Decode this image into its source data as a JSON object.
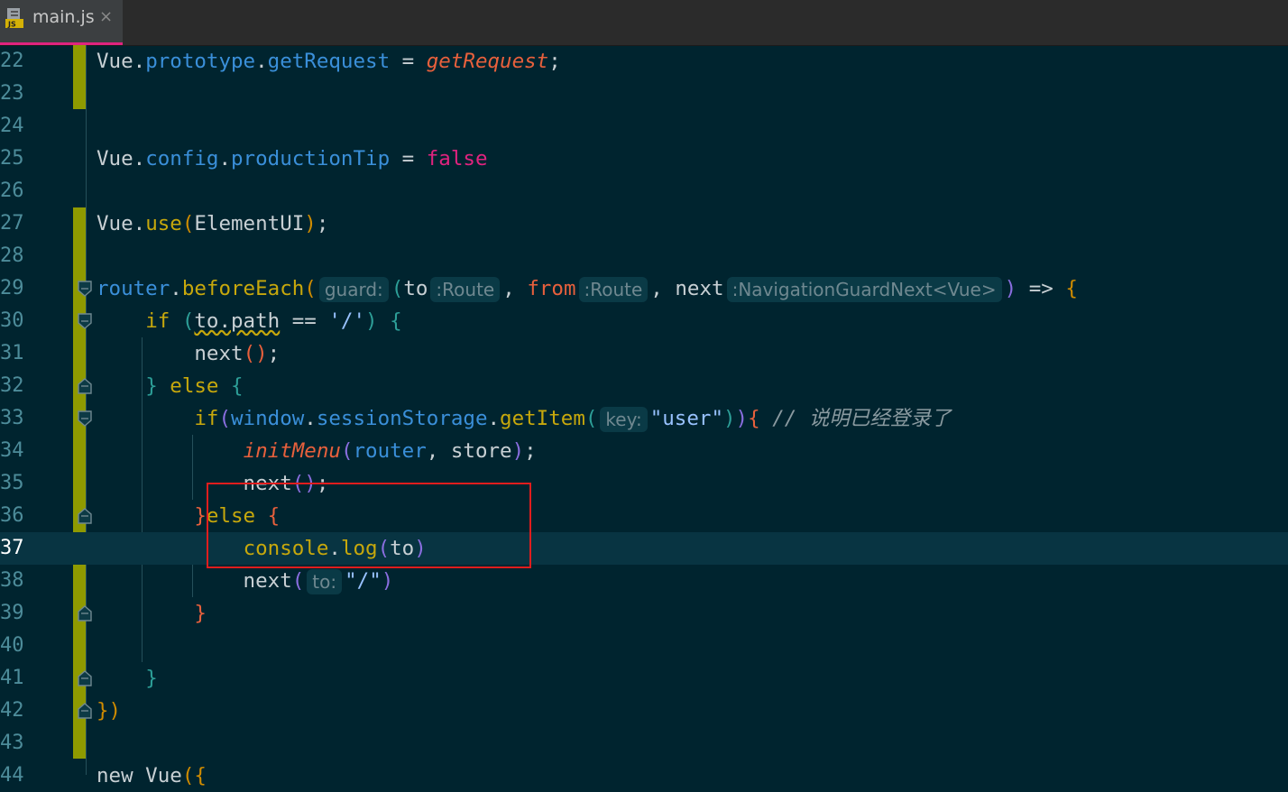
{
  "tab": {
    "filename": "main.js",
    "icon": "javascript-file-icon",
    "close": "×"
  },
  "lines": [
    {
      "n": "22",
      "parts": [
        [
          "Vue",
          ""
        ],
        [
          ".",
          ""
        ],
        [
          "prototype",
          "prop"
        ],
        [
          ".",
          ""
        ],
        [
          "getRequest",
          "prop"
        ],
        [
          " = ",
          ""
        ],
        [
          "getRequest",
          "ital"
        ],
        [
          ";",
          ""
        ]
      ]
    },
    {
      "n": "23",
      "parts": []
    },
    {
      "n": "24",
      "parts": []
    },
    {
      "n": "25",
      "parts": [
        [
          "Vue",
          ""
        ],
        [
          ".",
          ""
        ],
        [
          "config",
          "prop"
        ],
        [
          ".",
          ""
        ],
        [
          "productionTip",
          "prop"
        ],
        [
          " = ",
          ""
        ],
        [
          "false",
          "bool"
        ]
      ]
    },
    {
      "n": "26",
      "parts": []
    },
    {
      "n": "27",
      "parts": [
        [
          "Vue",
          ""
        ],
        [
          ".",
          ""
        ],
        [
          "use",
          "fn"
        ],
        [
          "(",
          "par1"
        ],
        [
          "ElementUI",
          ""
        ],
        [
          ")",
          "par1"
        ],
        [
          ";",
          ""
        ]
      ]
    },
    {
      "n": "28",
      "parts": []
    },
    {
      "n": "29",
      "parts": [
        [
          "router",
          "prop"
        ],
        [
          ".",
          ""
        ],
        [
          "beforeEach",
          "fn"
        ],
        [
          "(",
          "par1"
        ],
        [
          "guard:",
          "hint"
        ],
        [
          "(",
          "par3"
        ],
        [
          "to",
          ""
        ],
        [
          ":Route",
          "hint"
        ],
        [
          ", ",
          ""
        ],
        [
          "from",
          "par2"
        ],
        [
          ":Route",
          "hint"
        ],
        [
          ", ",
          ""
        ],
        [
          "next",
          ""
        ],
        [
          ":NavigationGuardNext<Vue>",
          "hint"
        ],
        [
          ")",
          "par4"
        ],
        [
          " => ",
          ""
        ],
        [
          "{",
          "par1"
        ]
      ]
    },
    {
      "n": "30",
      "parts": [
        [
          "    ",
          ""
        ],
        [
          "if",
          "kw"
        ],
        [
          " ",
          ""
        ],
        [
          "(",
          "par3"
        ],
        [
          "to.path",
          "wavy"
        ],
        [
          " == ",
          ""
        ],
        [
          "'/'",
          "str"
        ],
        [
          ")",
          "par3"
        ],
        [
          " {",
          "par3"
        ]
      ]
    },
    {
      "n": "31",
      "parts": [
        [
          "        next",
          ""
        ],
        [
          "(",
          "par2"
        ],
        [
          ")",
          "par2"
        ],
        [
          ";",
          ""
        ]
      ]
    },
    {
      "n": "32",
      "parts": [
        [
          "    ",
          ""
        ],
        [
          "}",
          "par3"
        ],
        [
          " else ",
          "kw"
        ],
        [
          "{",
          "par3"
        ]
      ]
    },
    {
      "n": "33",
      "parts": [
        [
          "        ",
          ""
        ],
        [
          "if",
          "kw"
        ],
        [
          "(",
          "par4"
        ],
        [
          "window",
          "prop"
        ],
        [
          ".",
          ""
        ],
        [
          "sessionStorage",
          "prop"
        ],
        [
          ".",
          ""
        ],
        [
          "getItem",
          "fn"
        ],
        [
          "(",
          "par3"
        ],
        [
          "key:",
          "hint"
        ],
        [
          "\"user\"",
          "str"
        ],
        [
          ")",
          "par3"
        ],
        [
          ")",
          "par4"
        ],
        [
          "{",
          "par2"
        ],
        [
          " ",
          ""
        ],
        [
          "// 说明已经登录了",
          "cmt"
        ]
      ]
    },
    {
      "n": "34",
      "parts": [
        [
          "            ",
          ""
        ],
        [
          "initMenu",
          "ital"
        ],
        [
          "(",
          "par4"
        ],
        [
          "router",
          "prop"
        ],
        [
          ", store",
          ""
        ],
        [
          ")",
          "par4"
        ],
        [
          ";",
          ""
        ]
      ]
    },
    {
      "n": "35",
      "parts": [
        [
          "            next",
          ""
        ],
        [
          "(",
          "par4"
        ],
        [
          ")",
          "par4"
        ],
        [
          ";",
          ""
        ]
      ]
    },
    {
      "n": "36",
      "parts": [
        [
          "        ",
          ""
        ],
        [
          "}",
          "par2"
        ],
        [
          "else",
          "kw"
        ],
        [
          " {",
          "par2"
        ]
      ]
    },
    {
      "n": "37",
      "parts": [
        [
          "            ",
          ""
        ],
        [
          "console",
          "kw"
        ],
        [
          ".",
          ""
        ],
        [
          "log",
          "fn"
        ],
        [
          "(",
          "par4"
        ],
        [
          "to",
          ""
        ],
        [
          ")",
          "par4"
        ]
      ]
    },
    {
      "n": "38",
      "parts": [
        [
          "            next",
          ""
        ],
        [
          "(",
          "par4"
        ],
        [
          "to:",
          "hint"
        ],
        [
          "\"/\"",
          "str"
        ],
        [
          ")",
          "par4"
        ]
      ]
    },
    {
      "n": "39",
      "parts": [
        [
          "        ",
          ""
        ],
        [
          "}",
          "par2"
        ]
      ]
    },
    {
      "n": "40",
      "parts": []
    },
    {
      "n": "41",
      "parts": [
        [
          "    ",
          ""
        ],
        [
          "}",
          "par3"
        ]
      ]
    },
    {
      "n": "42",
      "parts": [
        [
          "}",
          "par1"
        ],
        [
          ")",
          "par1"
        ]
      ]
    },
    {
      "n": "43",
      "parts": []
    },
    {
      "n": "44",
      "parts": [
        [
          "new Vue",
          ""
        ],
        [
          "({",
          "par1"
        ]
      ]
    }
  ],
  "current_line": "37"
}
